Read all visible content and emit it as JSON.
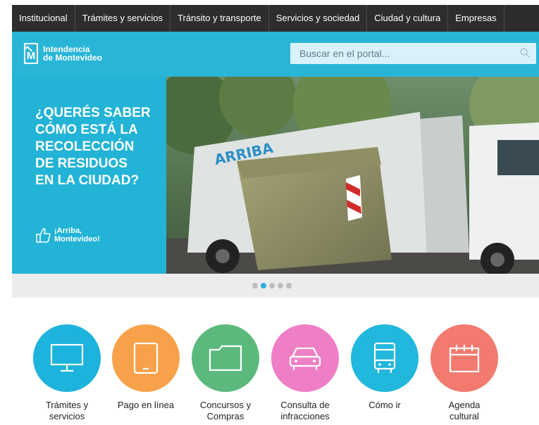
{
  "nav": {
    "items": [
      {
        "label": "Institucional"
      },
      {
        "label": "Trámites y servicios"
      },
      {
        "label": "Tránsito y transporte"
      },
      {
        "label": "Servicios y sociedad"
      },
      {
        "label": "Ciudad y cultura"
      },
      {
        "label": "Empresas"
      }
    ]
  },
  "header": {
    "logo_line1": "Intendencia",
    "logo_line2": "de Montevideo",
    "logo_letter": "M",
    "search_placeholder": "Buscar en el portal..."
  },
  "hero": {
    "headline_lines": [
      "¿QUERÉS SABER",
      "CÓMO ESTÁ LA",
      "RECOLECCIÓN",
      "DE RESIDUOS",
      "EN LA CIUDAD?"
    ],
    "brand_line1": "¡Arriba,",
    "brand_line2": "Montevideo!",
    "truck_text": "ARRIBA",
    "left_bg": "#22b3d6"
  },
  "carousel": {
    "slide_count": 5,
    "active_index": 1,
    "active_color": "#29aee0"
  },
  "quicklinks": [
    {
      "line1": "Trámites y",
      "line2": "servicios",
      "color": "#1eb3dc",
      "icon": "monitor-icon"
    },
    {
      "line1": "Pago en línea",
      "line2": "",
      "color": "#f7a24b",
      "icon": "tablet-icon"
    },
    {
      "line1": "Concursos y",
      "line2": "Compras",
      "color": "#5cb97e",
      "icon": "folder-icon"
    },
    {
      "line1": "Consulta de",
      "line2": "infracciones",
      "color": "#ee7fc6",
      "icon": "car-icon"
    },
    {
      "line1": "Cómo ir",
      "line2": "",
      "color": "#22b7dc",
      "icon": "bus-icon"
    },
    {
      "line1": "Agenda",
      "line2": "cultural",
      "color": "#f27a6e",
      "icon": "calendar-icon"
    }
  ]
}
